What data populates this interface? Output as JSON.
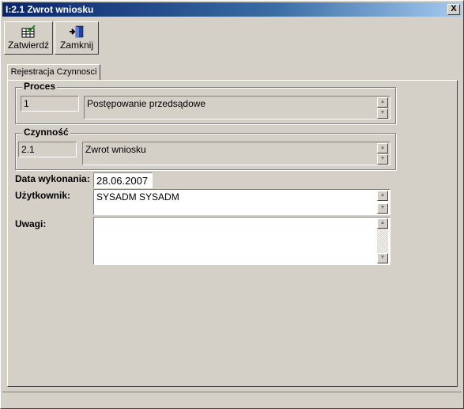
{
  "window": {
    "title": "I:2.1 Zwrot wniosku",
    "close_label": "X"
  },
  "toolbar": {
    "confirm_label": "Zatwierdź",
    "close_label": "Zamknij"
  },
  "tabs": [
    {
      "label": "Rejestracja Czynnosci",
      "active": true
    }
  ],
  "proces": {
    "title": "Proces",
    "code": "1",
    "name": "Postępowanie przedsądowe"
  },
  "czynnosc": {
    "title": "Czynność",
    "code": "2.1",
    "name": "Zwrot wniosku"
  },
  "data_wykonania": {
    "label": "Data wykonania:",
    "value": "28.06.2007"
  },
  "uzytkownik": {
    "label": "Użytkownik:",
    "value": "SYSADM SYSADM"
  },
  "uwagi": {
    "label": "Uwagi:",
    "value": ""
  },
  "colors": {
    "title_bar_start": "#0a246a",
    "window_bg": "#d4d0c8"
  },
  "icons": {
    "confirm": "grid-check-icon",
    "close": "exit-door-icon"
  }
}
